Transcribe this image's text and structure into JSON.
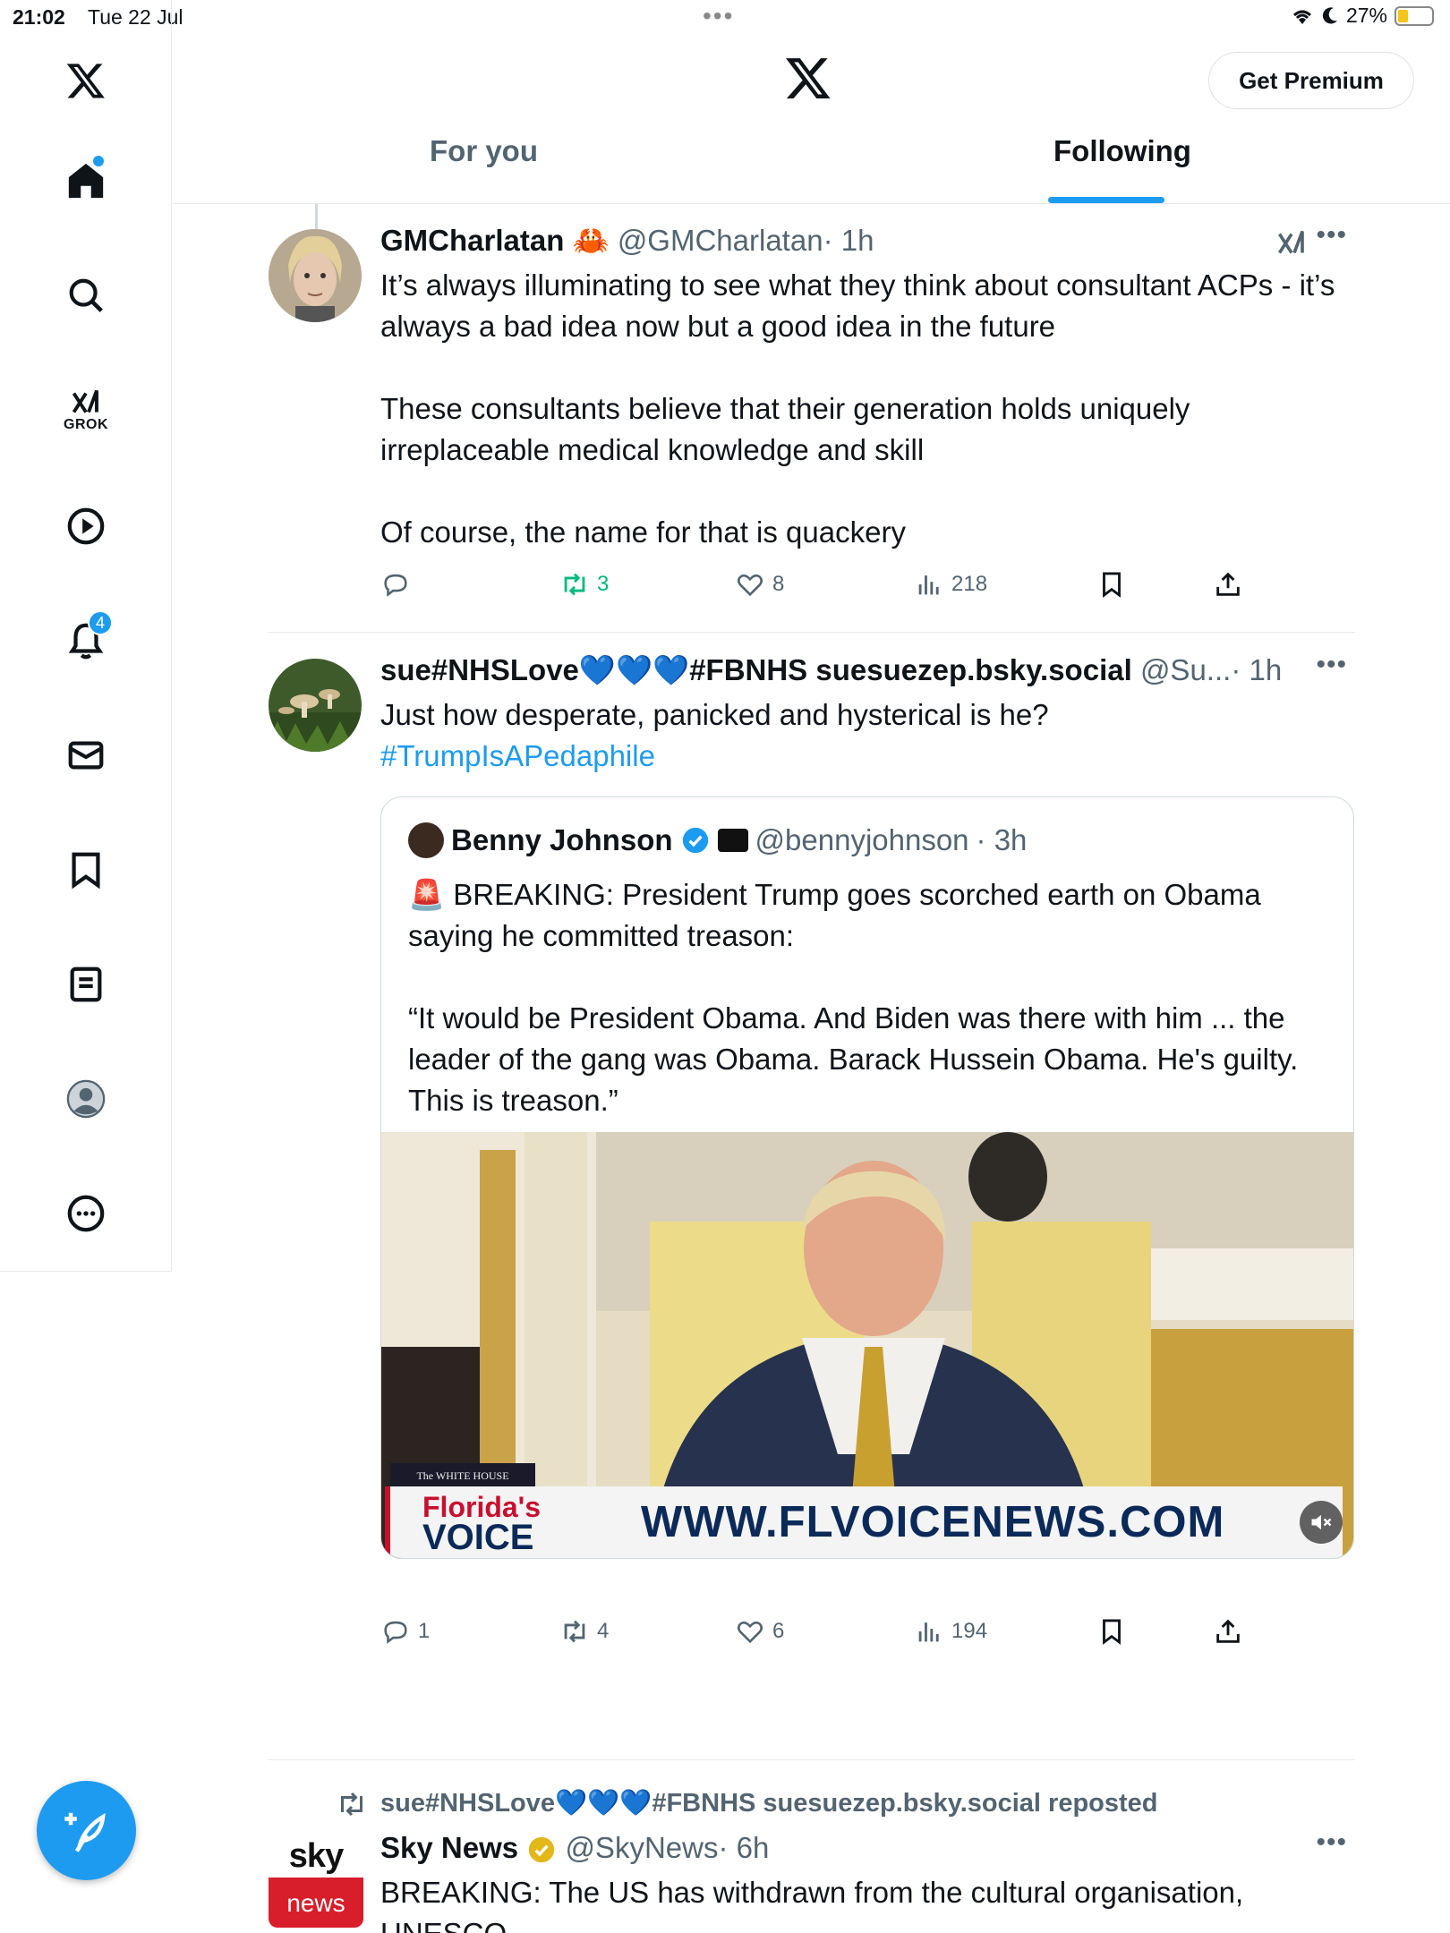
{
  "status": {
    "time": "21:02",
    "date": "Tue 22 Jul",
    "battery": "27%",
    "battery_level": 0.27
  },
  "sidebar": {
    "items": [
      "x-logo",
      "home",
      "search",
      "grok",
      "videos",
      "notifications",
      "messages",
      "bookmarks",
      "lists",
      "profile",
      "more"
    ],
    "grok_label": "GROK",
    "notifications_count": "4"
  },
  "header": {
    "premium_label": "Get Premium",
    "tabs": [
      "For you",
      "Following"
    ],
    "active_tab": "Following"
  },
  "tweets": [
    {
      "name": "GMCharlatan",
      "name_emoji": "🦀",
      "handle": "@GMCharlatan",
      "time": "· 1h",
      "paragraphs": [
        "It’s always illuminating to see what they think about consultant ACPs - it’s always a bad idea now but a good idea in the future",
        "These consultants believe that their generation holds uniquely irreplaceable medical knowledge and skill",
        "Of course, the name for that is quackery"
      ],
      "replies": "",
      "reposts": "3",
      "likes": "8",
      "views": "218"
    },
    {
      "name": "sue#NHSLove💙💙💙#FBNHS suesuezep.bsky.social",
      "handle": "@Su...",
      "time": "· 1h",
      "text": "Just how desperate, panicked and hysterical is he?",
      "hashtag": "#TrumpIsAPedaphile",
      "quote": {
        "name": "Benny Johnson",
        "handle": "@bennyjohnson",
        "time": "· 3h",
        "line1": "🚨 BREAKING: President Trump goes scorched earth on Obama saying he committed treason:",
        "line2": "“It would be President Obama. And Biden was there with him ... the leader of the gang was Obama. Barack Hussein Obama. He's guilty. This is treason.”",
        "media_banner_left_top": "Florida's",
        "media_banner_left_bottom": "VOICE",
        "media_banner_url": "WWW.FLVOICENEWS.COM",
        "media_tag": "The WHITE HOUSE"
      },
      "replies": "1",
      "reposts": "4",
      "likes": "6",
      "views": "194"
    },
    {
      "repost_by": "sue#NHSLove💙💙💙#FBNHS suesuezep.bsky.social reposted",
      "name": "Sky News",
      "handle": "@SkyNews",
      "time": "· 6h",
      "avatar_top": "sky",
      "avatar_bottom": "news",
      "text": "BREAKING: The US has withdrawn from the cultural organisation, UNESCO"
    }
  ],
  "colors": {
    "accent": "#1d9bf0",
    "repost_green": "#00ba7c",
    "muted": "#536471"
  }
}
